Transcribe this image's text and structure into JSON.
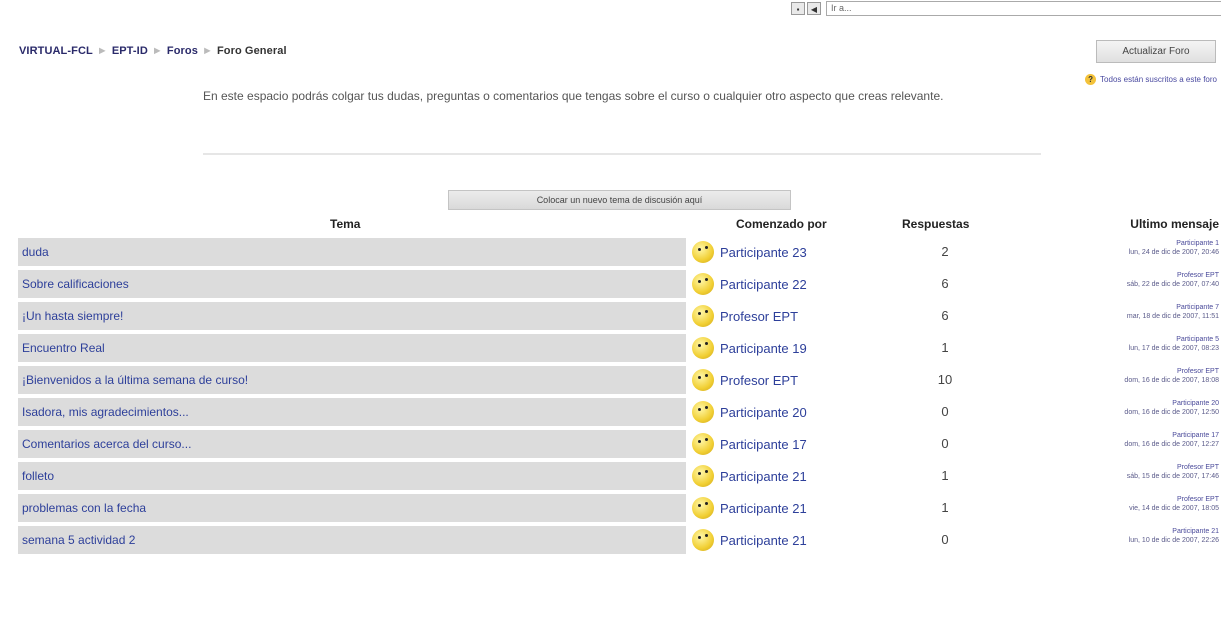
{
  "jump": {
    "placeholder": "Ir a..."
  },
  "breadcrumb": [
    "VIRTUAL-FCL",
    "EPT-ID",
    "Foros",
    "Foro General"
  ],
  "update_button": "Actualizar Foro",
  "subscribed_text": "Todos están suscritos a este foro",
  "intro": "En este espacio podrás colgar tus dudas, preguntas o comentarios que tengas sobre el curso o cualquier otro aspecto que creas relevante.",
  "new_topic_button": "Colocar un nuevo tema de discusión aquí",
  "headers": {
    "tema": "Tema",
    "comenzado": "Comenzado por",
    "respuestas": "Respuestas",
    "ultimo": "Ultimo mensaje"
  },
  "rows": [
    {
      "topic": "duda",
      "author": "Participante 23",
      "replies": "2",
      "last_who": "Participante 1",
      "last_when": "lun, 24 de dic de 2007, 20:46"
    },
    {
      "topic": "Sobre calificaciones",
      "author": "Participante 22",
      "replies": "6",
      "last_who": "Profesor EPT",
      "last_when": "sáb, 22 de dic de 2007, 07:40"
    },
    {
      "topic": "¡Un hasta siempre!",
      "author": "Profesor EPT",
      "replies": "6",
      "last_who": "Participante 7",
      "last_when": "mar, 18 de dic de 2007, 11:51"
    },
    {
      "topic": "Encuentro Real",
      "author": "Participante 19",
      "replies": "1",
      "last_who": "Participante 5",
      "last_when": "lun, 17 de dic de 2007, 08:23"
    },
    {
      "topic": "¡Bienvenidos a la última semana de curso!",
      "author": "Profesor EPT",
      "replies": "10",
      "last_who": "Profesor EPT",
      "last_when": "dom, 16 de dic de 2007, 18:08"
    },
    {
      "topic": "Isadora, mis agradecimientos...",
      "author": "Participante 20",
      "replies": "0",
      "last_who": "Participante 20",
      "last_when": "dom, 16 de dic de 2007, 12:50"
    },
    {
      "topic": "Comentarios acerca del curso...",
      "author": "Participante 17",
      "replies": "0",
      "last_who": "Participante 17",
      "last_when": "dom, 16 de dic de 2007, 12:27"
    },
    {
      "topic": "folleto",
      "author": "Participante 21",
      "replies": "1",
      "last_who": "Profesor EPT",
      "last_when": "sáb, 15 de dic de 2007, 17:46"
    },
    {
      "topic": "problemas con la fecha",
      "author": "Participante 21",
      "replies": "1",
      "last_who": "Profesor EPT",
      "last_when": "vie, 14 de dic de 2007, 18:05"
    },
    {
      "topic": "semana 5 actividad 2",
      "author": "Participante 21",
      "replies": "0",
      "last_who": "Participante 21",
      "last_when": "lun, 10 de dic de 2007, 22:26"
    }
  ]
}
